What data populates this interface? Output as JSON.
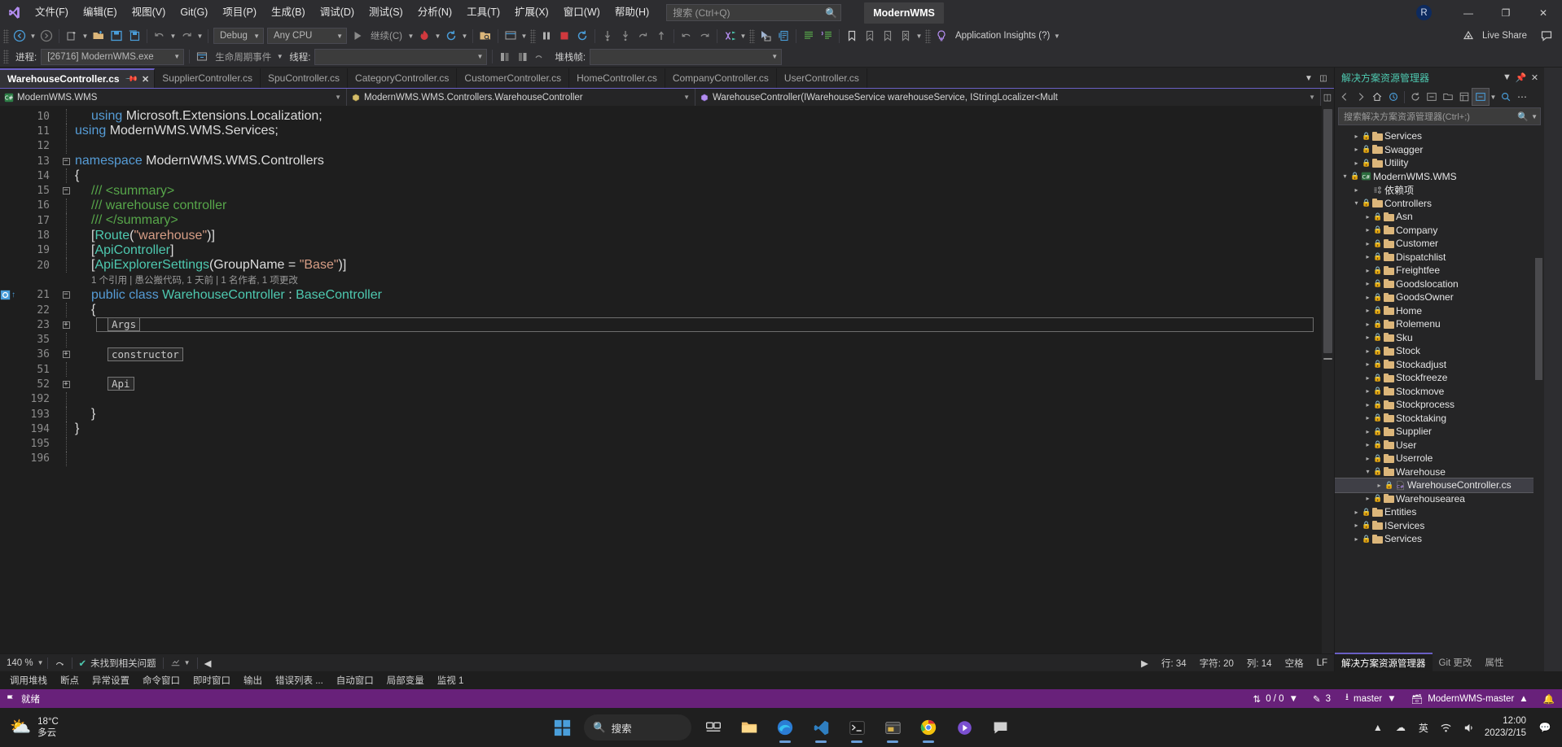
{
  "titlebar": {
    "logo": "visual-studio-logo",
    "menus": [
      "文件(F)",
      "编辑(E)",
      "视图(V)",
      "Git(G)",
      "项目(P)",
      "生成(B)",
      "调试(D)",
      "测试(S)",
      "分析(N)",
      "工具(T)",
      "扩展(X)",
      "窗口(W)",
      "帮助(H)"
    ],
    "search_placeholder": "搜索 (Ctrl+Q)",
    "project_title": "ModernWMS",
    "avatar_initial": "R",
    "minimize": "—",
    "maximize": "❐",
    "close": "✕"
  },
  "toolbar": {
    "config": "Debug",
    "platform": "Any CPU",
    "run_label": "继续(C)",
    "app_insights": "Application Insights (?)",
    "live_share": "Live Share"
  },
  "debugbar": {
    "process_label": "进程:",
    "process_value": "[26716] ModernWMS.exe",
    "lifecycle_label": "生命周期事件",
    "thread_label": "线程:",
    "thread_value": "",
    "stackframe_label": "堆栈帧:",
    "stackframe_value": ""
  },
  "tabs": [
    {
      "label": "WarehouseController.cs",
      "active": true
    },
    {
      "label": "SupplierController.cs",
      "active": false
    },
    {
      "label": "SpuController.cs",
      "active": false
    },
    {
      "label": "CategoryController.cs",
      "active": false
    },
    {
      "label": "CustomerController.cs",
      "active": false
    },
    {
      "label": "HomeController.cs",
      "active": false
    },
    {
      "label": "CompanyController.cs",
      "active": false
    },
    {
      "label": "UserController.cs",
      "active": false
    }
  ],
  "navbar": {
    "project": "ModernWMS.WMS",
    "type": "ModernWMS.WMS.Controllers.WarehouseController",
    "member": "WarehouseController(IWarehouseService warehouseService, IStringLocalizer<Mult"
  },
  "code": {
    "lines": [
      {
        "num": "10",
        "fold": "",
        "indent": 1,
        "tokens": [
          {
            "t": "using ",
            "c": "k"
          },
          {
            "t": "Microsoft.Extensions.Localization;",
            "c": "id"
          }
        ]
      },
      {
        "num": "11",
        "fold": "",
        "indent": 0,
        "tokens": [
          {
            "t": "using ",
            "c": "k"
          },
          {
            "t": "ModernWMS.WMS.Services;",
            "c": "id"
          }
        ]
      },
      {
        "num": "12",
        "fold": "",
        "indent": 0,
        "tokens": []
      },
      {
        "num": "13",
        "fold": "minus",
        "indent": 0,
        "tokens": [
          {
            "t": "namespace ",
            "c": "k"
          },
          {
            "t": "ModernWMS.WMS.Controllers",
            "c": "id"
          }
        ]
      },
      {
        "num": "14",
        "fold": "",
        "indent": 0,
        "tokens": [
          {
            "t": "{",
            "c": "p"
          }
        ]
      },
      {
        "num": "15",
        "fold": "minus",
        "indent": 1,
        "tokens": [
          {
            "t": "/// <summary>",
            "c": "c"
          }
        ]
      },
      {
        "num": "16",
        "fold": "",
        "indent": 1,
        "tokens": [
          {
            "t": "/// warehouse controller",
            "c": "c"
          }
        ]
      },
      {
        "num": "17",
        "fold": "",
        "indent": 1,
        "tokens": [
          {
            "t": "/// </summary>",
            "c": "c"
          }
        ]
      },
      {
        "num": "18",
        "fold": "",
        "indent": 1,
        "tokens": [
          {
            "t": "[",
            "c": "p"
          },
          {
            "t": "Route",
            "c": "t"
          },
          {
            "t": "(",
            "c": "p"
          },
          {
            "t": "\"warehouse\"",
            "c": "s"
          },
          {
            "t": ")]",
            "c": "p"
          }
        ]
      },
      {
        "num": "19",
        "fold": "",
        "indent": 1,
        "tokens": [
          {
            "t": "[",
            "c": "p"
          },
          {
            "t": "ApiController",
            "c": "t"
          },
          {
            "t": "]",
            "c": "p"
          }
        ]
      },
      {
        "num": "20",
        "fold": "",
        "indent": 1,
        "tokens": [
          {
            "t": "[",
            "c": "p"
          },
          {
            "t": "ApiExplorerSettings",
            "c": "t"
          },
          {
            "t": "(GroupName = ",
            "c": "p"
          },
          {
            "t": "\"Base\"",
            "c": "s"
          },
          {
            "t": ")]",
            "c": "p"
          }
        ]
      },
      {
        "num": "",
        "fold": "",
        "indent": 1,
        "codelens": "1 个引用 | 愚公搬代码, 1 天前 | 1 名作者, 1 项更改"
      },
      {
        "num": "21",
        "fold": "minus",
        "indent": 1,
        "breakpoint": true,
        "tokens": [
          {
            "t": "public class ",
            "c": "k"
          },
          {
            "t": "WarehouseController",
            "c": "t"
          },
          {
            "t": " : ",
            "c": "p"
          },
          {
            "t": "BaseController",
            "c": "t"
          }
        ]
      },
      {
        "num": "22",
        "fold": "",
        "indent": 1,
        "tokens": [
          {
            "t": "{",
            "c": "p"
          }
        ]
      },
      {
        "num": "23",
        "fold": "plus",
        "indent": 2,
        "collapsed": "Args",
        "selected": true
      },
      {
        "num": "35",
        "fold": "",
        "indent": 2,
        "tokens": []
      },
      {
        "num": "36",
        "fold": "plus",
        "indent": 2,
        "collapsed": "constructor"
      },
      {
        "num": "51",
        "fold": "",
        "indent": 2,
        "tokens": []
      },
      {
        "num": "52",
        "fold": "plus",
        "indent": 2,
        "collapsed": "Api"
      },
      {
        "num": "192",
        "fold": "",
        "indent": 2,
        "tokens": []
      },
      {
        "num": "193",
        "fold": "",
        "indent": 1,
        "tokens": [
          {
            "t": "}",
            "c": "p"
          }
        ]
      },
      {
        "num": "194",
        "fold": "",
        "indent": 0,
        "tokens": [
          {
            "t": "}",
            "c": "p"
          }
        ]
      },
      {
        "num": "195",
        "fold": "",
        "indent": 0,
        "tokens": []
      },
      {
        "num": "196",
        "fold": "",
        "indent": 0,
        "tokens": []
      }
    ]
  },
  "editor_status": {
    "zoom": "140 %",
    "issues": "未找到相关问题",
    "line": "行: 34",
    "char": "字符: 20",
    "col": "列: 14",
    "spaces": "空格",
    "eol": "LF"
  },
  "solution_explorer": {
    "title": "解决方案资源管理器",
    "search_placeholder": "搜索解决方案资源管理器(Ctrl+;)",
    "tree": [
      {
        "label": "Services",
        "depth": 1,
        "arrow": "right",
        "icon": "folder",
        "lock": true
      },
      {
        "label": "Swagger",
        "depth": 1,
        "arrow": "right",
        "icon": "folder",
        "lock": true
      },
      {
        "label": "Utility",
        "depth": 1,
        "arrow": "right",
        "icon": "folder",
        "lock": true
      },
      {
        "label": "ModernWMS.WMS",
        "depth": 0,
        "arrow": "down",
        "icon": "project",
        "lock": true
      },
      {
        "label": "依赖项",
        "depth": 1,
        "arrow": "right",
        "icon": "deps",
        "lock": false
      },
      {
        "label": "Controllers",
        "depth": 1,
        "arrow": "down",
        "icon": "folder",
        "lock": true
      },
      {
        "label": "Asn",
        "depth": 2,
        "arrow": "right",
        "icon": "folder",
        "lock": true
      },
      {
        "label": "Company",
        "depth": 2,
        "arrow": "right",
        "icon": "folder",
        "lock": true
      },
      {
        "label": "Customer",
        "depth": 2,
        "arrow": "right",
        "icon": "folder",
        "lock": true
      },
      {
        "label": "Dispatchlist",
        "depth": 2,
        "arrow": "right",
        "icon": "folder",
        "lock": true
      },
      {
        "label": "Freightfee",
        "depth": 2,
        "arrow": "right",
        "icon": "folder",
        "lock": true
      },
      {
        "label": "Goodslocation",
        "depth": 2,
        "arrow": "right",
        "icon": "folder",
        "lock": true
      },
      {
        "label": "GoodsOwner",
        "depth": 2,
        "arrow": "right",
        "icon": "folder",
        "lock": true
      },
      {
        "label": "Home",
        "depth": 2,
        "arrow": "right",
        "icon": "folder",
        "lock": true
      },
      {
        "label": "Rolemenu",
        "depth": 2,
        "arrow": "right",
        "icon": "folder",
        "lock": true
      },
      {
        "label": "Sku",
        "depth": 2,
        "arrow": "right",
        "icon": "folder",
        "lock": true
      },
      {
        "label": "Stock",
        "depth": 2,
        "arrow": "right",
        "icon": "folder",
        "lock": true
      },
      {
        "label": "Stockadjust",
        "depth": 2,
        "arrow": "right",
        "icon": "folder",
        "lock": true
      },
      {
        "label": "Stockfreeze",
        "depth": 2,
        "arrow": "right",
        "icon": "folder",
        "lock": true
      },
      {
        "label": "Stockmove",
        "depth": 2,
        "arrow": "right",
        "icon": "folder",
        "lock": true
      },
      {
        "label": "Stockprocess",
        "depth": 2,
        "arrow": "right",
        "icon": "folder",
        "lock": true
      },
      {
        "label": "Stocktaking",
        "depth": 2,
        "arrow": "right",
        "icon": "folder",
        "lock": true
      },
      {
        "label": "Supplier",
        "depth": 2,
        "arrow": "right",
        "icon": "folder",
        "lock": true
      },
      {
        "label": "User",
        "depth": 2,
        "arrow": "right",
        "icon": "folder",
        "lock": true
      },
      {
        "label": "Userrole",
        "depth": 2,
        "arrow": "right",
        "icon": "folder",
        "lock": true
      },
      {
        "label": "Warehouse",
        "depth": 2,
        "arrow": "down",
        "icon": "folder",
        "lock": true
      },
      {
        "label": "WarehouseController.cs",
        "depth": 3,
        "arrow": "right",
        "icon": "cs",
        "lock": true,
        "selected": true
      },
      {
        "label": "Warehousearea",
        "depth": 2,
        "arrow": "right",
        "icon": "folder",
        "lock": true
      },
      {
        "label": "Entities",
        "depth": 1,
        "arrow": "right",
        "icon": "folder",
        "lock": true
      },
      {
        "label": "IServices",
        "depth": 1,
        "arrow": "right",
        "icon": "folder",
        "lock": true
      },
      {
        "label": "Services",
        "depth": 1,
        "arrow": "right",
        "icon": "folder",
        "lock": true
      }
    ],
    "bottom_tabs": [
      {
        "label": "解决方案资源管理器",
        "active": true
      },
      {
        "label": "Git 更改",
        "active": false
      },
      {
        "label": "属性",
        "active": false
      }
    ]
  },
  "bottom_panel": {
    "tabs": [
      "调用堆栈",
      "断点",
      "异常设置",
      "命令窗口",
      "即时窗口",
      "输出",
      "错误列表 ...",
      "自动窗口",
      "局部变量",
      "监视 1"
    ]
  },
  "status_bar": {
    "ready": "就绪",
    "changes": "0 / 0",
    "edits": "3",
    "branch": "master",
    "repo": "ModernWMS-master"
  },
  "taskbar": {
    "weather_temp": "18°C",
    "weather_desc": "多云",
    "search_label": "搜索",
    "clock_time": "12:00",
    "clock_date": "2023/2/15",
    "ime": "英",
    "apps": [
      {
        "name": "start-button"
      },
      {
        "name": "taskview-button"
      },
      {
        "name": "file-explorer"
      },
      {
        "name": "edge-browser"
      },
      {
        "name": "vscode"
      },
      {
        "name": "terminal"
      },
      {
        "name": "app-window"
      },
      {
        "name": "chrome-browser"
      },
      {
        "name": "media-player"
      },
      {
        "name": "chat-app"
      }
    ]
  },
  "colors": {
    "accent_purple": "#68217a",
    "tab_active": "#6a5fc4",
    "folder": "#dcb67a"
  }
}
